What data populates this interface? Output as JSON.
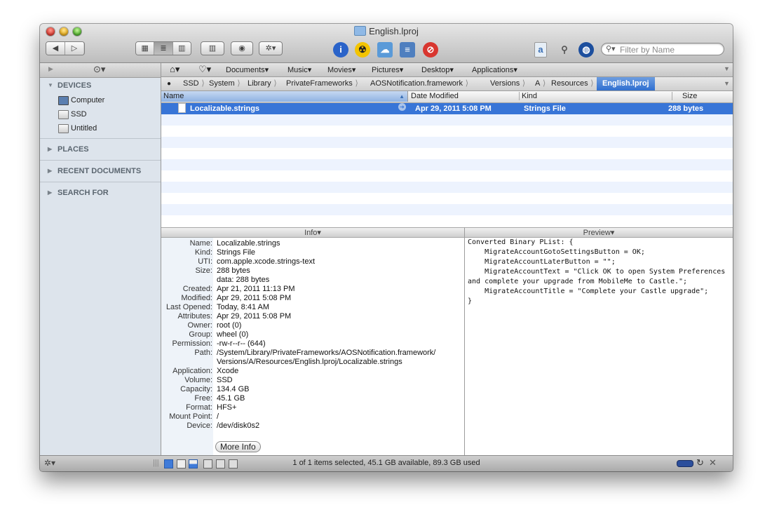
{
  "window": {
    "title": "English.lproj"
  },
  "toolbar": {
    "back": "◀",
    "forward": "▷",
    "views": [
      "▦",
      "≣",
      "▥"
    ],
    "coverflow": "▥",
    "quicklook": "◉",
    "action": "✲▾",
    "search_placeholder": "Filter by Name"
  },
  "sidebar": {
    "sections": [
      {
        "title": "DEVICES",
        "items": [
          "Computer",
          "SSD",
          "Untitled"
        ]
      },
      {
        "title": "PLACES"
      },
      {
        "title": "RECENT DOCUMENTS"
      },
      {
        "title": "SEARCH FOR"
      }
    ]
  },
  "favorites": [
    "Documents",
    "Music",
    "Movies",
    "Pictures",
    "Desktop",
    "Applications"
  ],
  "path": [
    "SSD",
    "System",
    "Library",
    "PrivateFrameworks",
    "AOSNotification.framework",
    "Versions",
    "A",
    "Resources",
    "English.lproj"
  ],
  "columns": {
    "name": "Name",
    "date": "Date Modified",
    "kind": "Kind",
    "size": "Size"
  },
  "files": [
    {
      "name": "Localizable.strings",
      "date": "Apr 29, 2011 5:08 PM",
      "kind": "Strings File",
      "size": "288 bytes"
    }
  ],
  "info_header": "Info▾",
  "preview_header": "Preview▾",
  "info": {
    "name_k": "Name:",
    "name_v": "Localizable.strings",
    "kind_k": "Kind:",
    "kind_v": "Strings File",
    "uti_k": "UTI:",
    "uti_v": "com.apple.xcode.strings-text",
    "size_k": "Size:",
    "size_v": "288 bytes",
    "data_v": "data: 288 bytes",
    "created_k": "Created:",
    "created_v": "Apr 21, 2011 11:13 PM",
    "modified_k": "Modified:",
    "modified_v": "Apr 29, 2011 5:08 PM",
    "opened_k": "Last Opened:",
    "opened_v": "Today, 8:41 AM",
    "attr_k": "Attributes:",
    "attr_v": "Apr 29, 2011 5:08 PM",
    "owner_k": "Owner:",
    "owner_v": "root (0)",
    "group_k": "Group:",
    "group_v": "wheel (0)",
    "perm_k": "Permission:",
    "perm_v": "-rw-r--r-- (644)",
    "path_k": "Path:",
    "path_v1": "/System/Library/PrivateFrameworks/AOSNotification.framework/",
    "path_v2": "Versions/A/Resources/English.lproj/Localizable.strings",
    "app_k": "Application:",
    "app_v": "Xcode",
    "vol_k": "Volume:",
    "vol_v": "SSD",
    "cap_k": "Capacity:",
    "cap_v": "134.4 GB",
    "free_k": "Free:",
    "free_v": "45.1 GB",
    "fmt_k": "Format:",
    "fmt_v": "HFS+",
    "mount_k": "Mount Point:",
    "mount_v": "/",
    "dev_k": "Device:",
    "dev_v": "/dev/disk0s2",
    "more_info": "More Info"
  },
  "preview_text": "Converted Binary PList: {\n    MigrateAccountGotoSettingsButton = OK;\n    MigrateAccountLaterButton = \"\";\n    MigrateAccountText = \"Click OK to open System Preferences\nand complete your upgrade from MobileMe to Castle.\";\n    MigrateAccountTitle = \"Complete your Castle upgrade\";\n}",
  "status": "1 of 1 items selected, 45.1 GB available, 89.3 GB used"
}
